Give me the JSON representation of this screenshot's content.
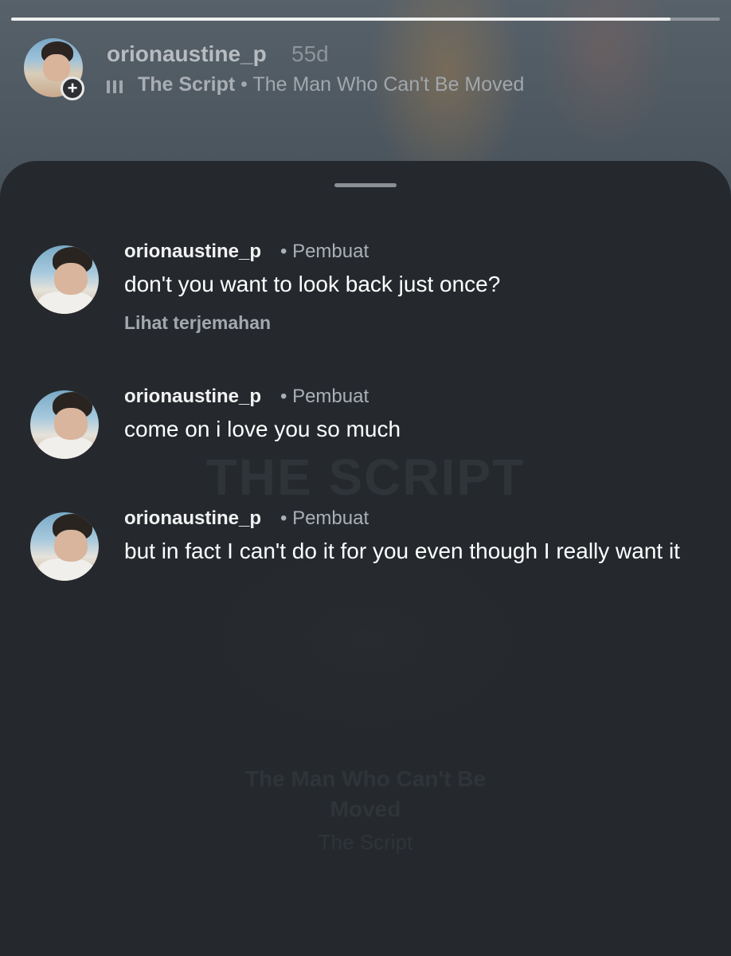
{
  "story": {
    "progress": 0.93,
    "username": "orionaustine_p",
    "time_ago": "55d",
    "music": {
      "artist": "The Script",
      "separator": "•",
      "song": "The Man Who Can't Be Moved"
    },
    "add_symbol": "+"
  },
  "background_card": {
    "title_line1": "The Man Who Can't Be",
    "title_line2": "Moved",
    "artist": "The Script",
    "logo_text": "THE SCRIPT"
  },
  "comments": [
    {
      "username": "orionaustine_p",
      "tag": "• Pembuat",
      "text": "don't you want to look back just once?",
      "translate": "Lihat terjemahan"
    },
    {
      "username": "orionaustine_p",
      "tag": "• Pembuat",
      "text": "come on i love you so much"
    },
    {
      "username": "orionaustine_p",
      "tag": "• Pembuat",
      "text": "but in fact I can't do it for you even though I really want it"
    }
  ],
  "colors": {
    "sheet": "#25292e",
    "text_primary": "#ffffff",
    "text_secondary": "#aab0b6"
  }
}
